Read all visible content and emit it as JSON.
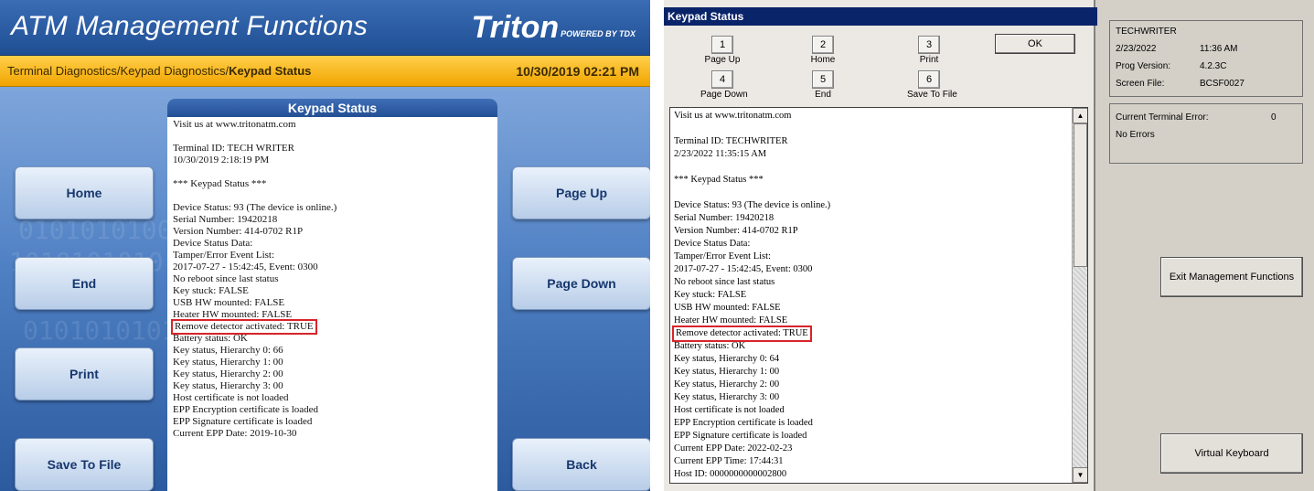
{
  "left": {
    "title": "ATM Management Functions",
    "brand": {
      "logo": "Triton",
      "powered": "POWERED BY TDX"
    },
    "breadcrumb": {
      "path": "Terminal Diagnostics/Keypad Diagnostics/",
      "current": "Keypad Status"
    },
    "datetime": "10/30/2019  02:21 PM",
    "buttons": {
      "home": "Home",
      "end": "End",
      "print": "Print",
      "save": "Save To File",
      "page_up": "Page Up",
      "page_down": "Page Down",
      "back": "Back"
    },
    "panel_title": "Keypad Status",
    "lines": [
      "Visit us at www.tritonatm.com",
      "",
      "Terminal ID: TECH WRITER",
      "10/30/2019 2:18:19 PM",
      "",
      "*** Keypad Status ***",
      "",
      "Device Status: 93 (The device is online.)",
      "Serial Number: 19420218",
      "Version Number: 414-0702 R1P",
      "Device Status Data:",
      "Tamper/Error Event List:",
      "2017-07-27 - 15:42:45, Event: 0300",
      "No reboot since last status",
      "Key stuck: FALSE",
      "USB HW mounted: FALSE",
      "Heater HW mounted: FALSE",
      "Remove detector activated: TRUE",
      "Battery status: OK",
      "Key status, Hierarchy 0: 66",
      "Key status, Hierarchy 1: 00",
      "Key status, Hierarchy 2: 00",
      "Key status, Hierarchy 3: 00",
      "Host certificate is not loaded",
      "EPP Encryption certificate is loaded",
      "EPP Signature certificate is loaded",
      "Current EPP Date: 2019-10-30"
    ]
  },
  "right": {
    "window_title": "Keypad Status",
    "keys": [
      {
        "num": "1",
        "label": "Page Up"
      },
      {
        "num": "2",
        "label": "Home"
      },
      {
        "num": "3",
        "label": "Print"
      },
      {
        "num": "4",
        "label": "Page Down"
      },
      {
        "num": "5",
        "label": "End"
      },
      {
        "num": "6",
        "label": "Save To File"
      }
    ],
    "ok": "OK",
    "lines": [
      "Visit us at www.tritonatm.com",
      "",
      "Terminal ID: TECHWRITER",
      "2/23/2022 11:35:15 AM",
      "",
      "*** Keypad Status ***",
      "",
      "Device Status: 93 (The device is online.)",
      "Serial Number: 19420218",
      "Version Number: 414-0702 R1P",
      "Device Status Data:",
      "Tamper/Error Event List:",
      "2017-07-27 - 15:42:45, Event: 0300",
      "No reboot since last status",
      "Key stuck: FALSE",
      "USB HW mounted: FALSE",
      "Heater HW mounted: FALSE",
      "Remove detector activated: TRUE",
      "Battery status: OK",
      "Key status, Hierarchy 0: 64",
      "Key status, Hierarchy 1: 00",
      "Key status, Hierarchy 2: 00",
      "Key status, Hierarchy 3: 00",
      "Host certificate is not loaded",
      "EPP Encryption certificate is loaded",
      "EPP Signature certificate is loaded",
      "Current EPP Date: 2022-02-23",
      "Current EPP Time: 17:44:31",
      "Host ID: 0000000000002800"
    ],
    "info": {
      "name": "TECHWRITER",
      "date": "2/23/2022",
      "time": "11:36 AM",
      "prog_label": "Prog Version:",
      "prog_value": "4.2.3C",
      "screen_label": "Screen File:",
      "screen_value": "BCSF0027"
    },
    "error": {
      "label": "Current Terminal Error:",
      "code": "0",
      "text": "No Errors"
    },
    "exit_button": "Exit Management Functions",
    "keyboard_button": "Virtual Keyboard"
  },
  "highlight_line": "Remove detector activated: TRUE",
  "colors": {
    "header_blue": "#1f4e93",
    "crumb_gold": "#f1a400",
    "highlight_red": "#d9232a",
    "win_title": "#0a246a"
  }
}
